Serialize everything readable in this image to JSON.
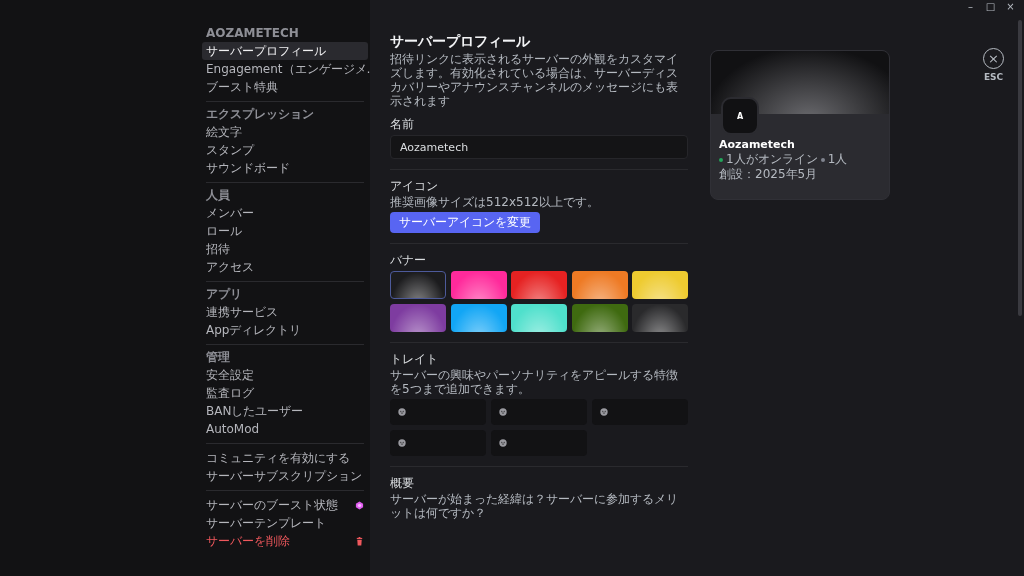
{
  "window": {
    "controls": [
      "–",
      "□",
      "×"
    ]
  },
  "sidebar": {
    "sections": [
      {
        "header": "AOZAMETECH",
        "items": [
          {
            "label": "サーバープロフィール",
            "kind": "normal",
            "selected": true
          },
          {
            "label": "Engagement（エンゲージメ…",
            "kind": "normal",
            "selected": false
          },
          {
            "label": "ブースト特典",
            "kind": "normal",
            "selected": false
          }
        ]
      },
      {
        "header": "エクスプレッション",
        "items": [
          {
            "label": "絵文字",
            "kind": "normal",
            "selected": false
          },
          {
            "label": "スタンプ",
            "kind": "normal",
            "selected": false
          },
          {
            "label": "サウンドボード",
            "kind": "normal",
            "selected": false
          }
        ]
      },
      {
        "header": "人員",
        "items": [
          {
            "label": "メンバー",
            "kind": "normal",
            "selected": false
          },
          {
            "label": "ロール",
            "kind": "normal",
            "selected": false
          },
          {
            "label": "招待",
            "kind": "normal",
            "selected": false
          },
          {
            "label": "アクセス",
            "kind": "normal",
            "selected": false
          }
        ]
      },
      {
        "header": "アプリ",
        "items": [
          {
            "label": "連携サービス",
            "kind": "normal",
            "selected": false
          },
          {
            "label": "Appディレクトリ",
            "kind": "normal",
            "selected": false
          }
        ]
      },
      {
        "header": "管理",
        "items": [
          {
            "label": "安全設定",
            "kind": "normal",
            "selected": false
          },
          {
            "label": "監査ログ",
            "kind": "normal",
            "selected": false
          },
          {
            "label": "BANしたユーザー",
            "kind": "normal",
            "selected": false
          },
          {
            "label": "AutoMod",
            "kind": "normal",
            "selected": false
          }
        ]
      },
      {
        "items": [
          {
            "label": "コミュニティを有効にする",
            "kind": "normal",
            "selected": false
          },
          {
            "label": "サーバーサブスクリプション",
            "kind": "normal",
            "selected": false
          }
        ]
      },
      {
        "items": [
          {
            "label": "サーバーのブースト状態",
            "kind": "boost",
            "selected": false
          },
          {
            "label": "サーバーテンプレート",
            "kind": "normal",
            "selected": false
          },
          {
            "label": "サーバーを削除",
            "kind": "danger",
            "selected": false
          }
        ]
      }
    ]
  },
  "main": {
    "title": "サーバープロフィール",
    "description": "招待リンクに表示されるサーバーの外観をカスタマイズします。有効化されている場合は、サーバーディスカバリーやアナウンスチャンネルのメッセージにも表示されます",
    "name": {
      "label": "名前",
      "value": "Aozametech"
    },
    "icon": {
      "label": "アイコン",
      "hint": "推奨画像サイズは512x512以上です。",
      "button": "サーバーアイコンを変更"
    },
    "banner": {
      "label": "バナー",
      "swatches": [
        {
          "color": "#1c1c1e",
          "selected": true
        },
        {
          "color": "#ff2a9b",
          "selected": false
        },
        {
          "color": "#e62222",
          "selected": false
        },
        {
          "color": "#ee7a24",
          "selected": false
        },
        {
          "color": "#eecb30",
          "selected": false
        },
        {
          "color": "#7e3ca0",
          "selected": false
        },
        {
          "color": "#12a6f5",
          "selected": false
        },
        {
          "color": "#4fe0cc",
          "selected": false
        },
        {
          "color": "#3f6a10",
          "selected": false
        },
        {
          "color": "#2a2a2c",
          "selected": false
        }
      ]
    },
    "traits": {
      "label": "トレイト",
      "description": "サーバーの興味やパーソナリティをアピールする特徴を5つまで追加できます。",
      "slots": [
        {
          "kind": "empty"
        },
        {
          "kind": "empty"
        },
        {
          "kind": "empty"
        },
        {
          "kind": "empty"
        },
        {
          "kind": "empty"
        }
      ]
    },
    "overview": {
      "label": "概要",
      "question": "サーバーが始まった経緯は？サーバーに参加するメリットは何ですか？"
    }
  },
  "preview": {
    "avatar": "A",
    "name": "Aozametech",
    "online": "1人がオンライン",
    "members": "1人",
    "created": "創設：2025年5月"
  },
  "close": {
    "icon": "×",
    "label": "ESC"
  }
}
